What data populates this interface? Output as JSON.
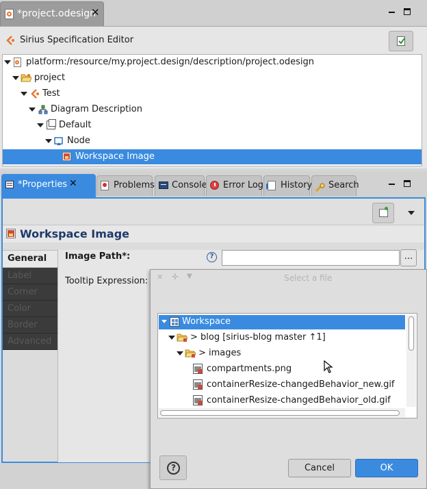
{
  "editor": {
    "tab_label": "*project.odesign",
    "header_title": "Sirius Specification Editor",
    "tree": [
      {
        "label": "platform:/resource/my.project.design/description/project.odesign",
        "icon": "odesign-file-icon"
      },
      {
        "label": "project",
        "icon": "folder-open-icon"
      },
      {
        "label": "Test",
        "icon": "viewpoint-icon"
      },
      {
        "label": "Diagram Description",
        "icon": "diagram-description-icon"
      },
      {
        "label": "Default",
        "icon": "layer-icon"
      },
      {
        "label": "Node",
        "icon": "node-mapping-icon"
      },
      {
        "label": "Workspace Image",
        "icon": "workspace-image-icon",
        "selected": true
      }
    ]
  },
  "properties": {
    "tabs": [
      {
        "label": "*Properties",
        "active": true,
        "icon": "properties-icon"
      },
      {
        "label": "Problems",
        "icon": "problems-icon"
      },
      {
        "label": "Console",
        "icon": "console-icon"
      },
      {
        "label": "Error Log",
        "icon": "error-log-icon"
      },
      {
        "label": "History",
        "icon": "history-icon"
      },
      {
        "label": "Search",
        "icon": "search-icon"
      }
    ],
    "title": "Workspace Image",
    "side_tabs": [
      "General",
      "Label",
      "Corner",
      "Color",
      "Border",
      "Advanced"
    ],
    "fields": {
      "image_path_label": "Image Path*:",
      "image_path_value": "",
      "browse_button": "...",
      "tooltip_label": "Tooltip Expression:"
    }
  },
  "dialog": {
    "title": "Select a file",
    "tree": [
      {
        "label": "Workspace",
        "selected": true
      },
      {
        "label": "> blog  [sirius-blog master ↑1]"
      },
      {
        "label": "> images"
      },
      {
        "label": "compartments.png"
      },
      {
        "label": "containerResize-changedBehavior_new.gif"
      },
      {
        "label": "containerResize-changedBehavior_old.gif"
      }
    ],
    "help_button": "?",
    "cancel_button": "Cancel",
    "ok_button": "OK"
  },
  "colors": {
    "selection": "#3a8be0",
    "brand_orange": "#e8742a"
  }
}
